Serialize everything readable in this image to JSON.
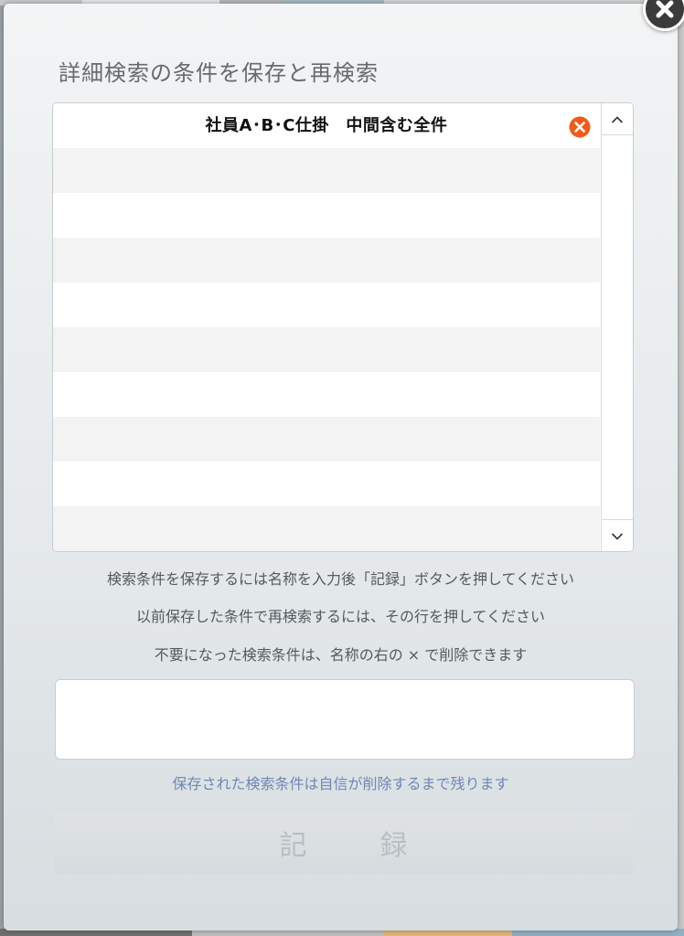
{
  "dialog": {
    "title": "詳細検索の条件を保存と再検索",
    "close_icon": "close-icon"
  },
  "saved_list": {
    "rows": [
      {
        "label": "社員A･B･C仕掛　中間含む全件",
        "delete_icon": "remove-circle-icon"
      },
      {
        "label": ""
      },
      {
        "label": ""
      },
      {
        "label": ""
      },
      {
        "label": ""
      },
      {
        "label": ""
      },
      {
        "label": ""
      },
      {
        "label": ""
      },
      {
        "label": ""
      },
      {
        "label": ""
      }
    ],
    "scroll_up_icon": "chevron-up-icon",
    "scroll_down_icon": "chevron-down-icon"
  },
  "help": {
    "line1": "検索条件を保存するには名称を入力後「記録」ボタンを押してください",
    "line2": "以前保存した条件で再検索するには、その行を押してください",
    "line3": "不要になった検索条件は、名称の右の × で削除できます"
  },
  "name_input": {
    "value": "",
    "placeholder": ""
  },
  "persist_note": "保存された検索条件は自信が削除するまで残ります",
  "record_button": {
    "label": "記録",
    "enabled": false
  },
  "colors": {
    "delete_icon": "#f05a1a",
    "note_text": "#6f86b8",
    "title_text": "#666b6f"
  }
}
